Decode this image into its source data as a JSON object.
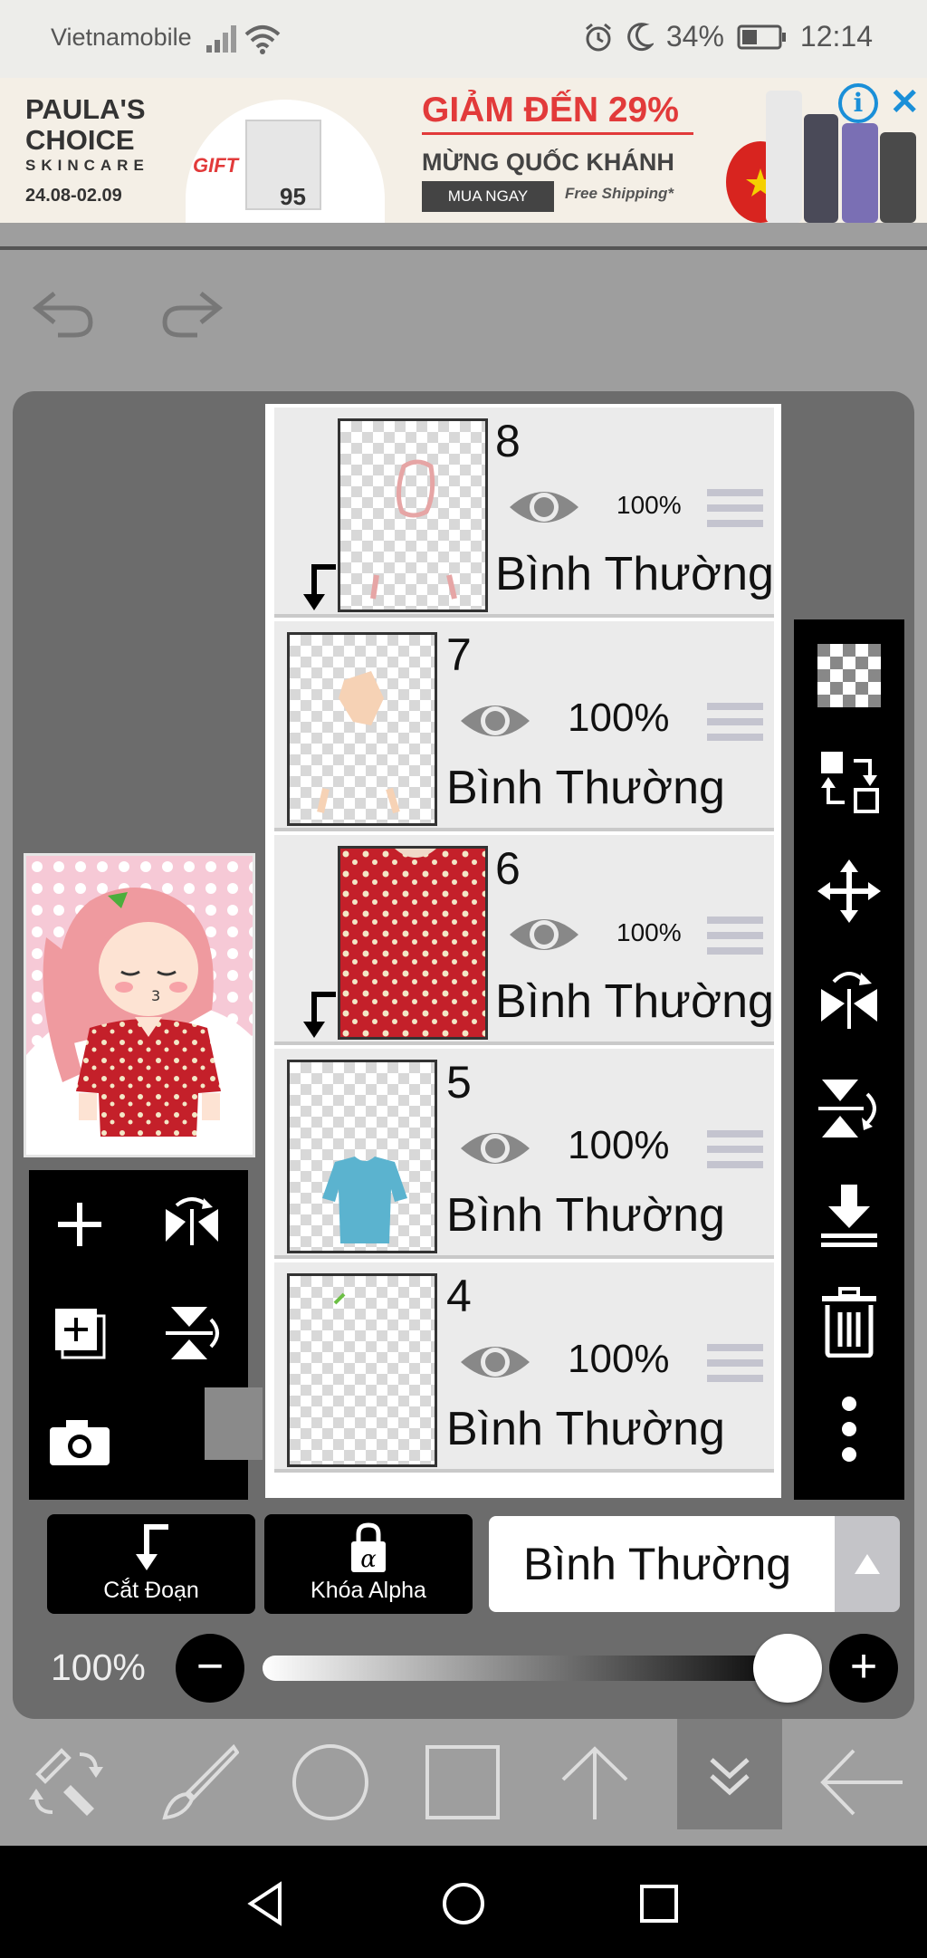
{
  "status_bar": {
    "carrier": "Vietnamobile",
    "battery": "34%",
    "time": "12:14"
  },
  "ad": {
    "brand_line1": "PAULA'S",
    "brand_line2": "CHOICE",
    "brand_sub": "SKINCARE",
    "date": "24.08-02.09",
    "gift_label": "GIFT",
    "bag_number": "95",
    "headline": "GIẢM ĐẾN 29%",
    "subline": "MỪNG QUỐC KHÁNH",
    "cta": "MUA NGAY",
    "shipping": "Free Shipping*"
  },
  "layers": [
    {
      "number": "8",
      "opacity": "100%",
      "blend": "Bình Thường",
      "clipped": true
    },
    {
      "number": "7",
      "opacity": "100%",
      "blend": "Bình Thường",
      "clipped": false
    },
    {
      "number": "6",
      "opacity": "100%",
      "blend": "Bình Thường",
      "clipped": true
    },
    {
      "number": "5",
      "opacity": "100%",
      "blend": "Bình Thường",
      "clipped": false
    },
    {
      "number": "4",
      "opacity": "100%",
      "blend": "Bình Thường",
      "clipped": false
    }
  ],
  "controls": {
    "clip_label": "Cắt Đoạn",
    "alpha_lock_label": "Khóa Alpha",
    "blend_mode": "Bình Thường",
    "opacity": "100%",
    "opacity_value": 1.0
  },
  "icons": {
    "left_toolbar": [
      "plus-icon",
      "flip-horizontal-icon",
      "add-layer-icon",
      "flip-vertical-icon",
      "camera-icon"
    ],
    "right_toolbar": [
      "checkerboard-icon",
      "transform-layer-icon",
      "move-icon",
      "flip-icon",
      "rotate-flip-icon",
      "merge-down-icon",
      "trash-icon",
      "more-icon"
    ],
    "bottom_tools": [
      "transform-tool-icon",
      "brush-icon",
      "circle-icon",
      "square-icon",
      "arrow-up-icon",
      "chevron-down-double-icon",
      "arrow-left-icon"
    ]
  },
  "colors": {
    "ad_red": "#e23a3a",
    "ad_blue": "#1a8fd8",
    "panel_gray": "#6c6c6c"
  }
}
